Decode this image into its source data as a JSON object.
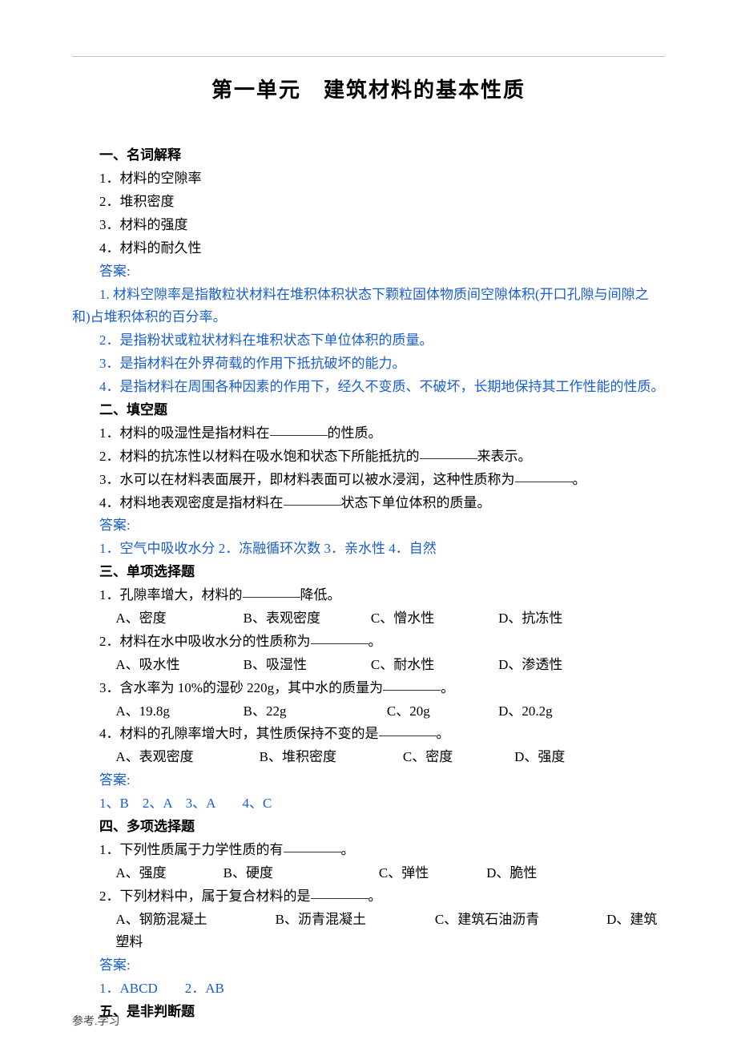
{
  "title": "第一单元　建筑材料的基本性质",
  "s1": {
    "heading": "一、名词解释",
    "items": [
      "1．材料的空隙率",
      "2．堆积密度",
      "3．材料的强度",
      "4．材料的耐久性"
    ],
    "answer_label": "答案:",
    "answers": [
      "1. 材料空隙率是指散粒状材料在堆积体积状态下颗粒固体物质间空隙体积(开口孔隙与间隙之和)占堆积体积的百分率。",
      "2．是指粉状或粒状材料在堆积状态下单位体积的质量。",
      "3．是指材料在外界荷载的作用下抵抗破坏的能力。",
      "4．是指材料在周围各种因素的作用下，经久不变质、不破坏，长期地保持其工作性能的性质。"
    ]
  },
  "s2": {
    "heading": "二、填空题",
    "q1a": "1．材料的吸湿性是指材料在",
    "q1b": "的性质。",
    "q2a": "2．材料的抗冻性以材料在吸水饱和状态下所能抵抗的",
    "q2b": "来表示。",
    "q3a": "3．水可以在材料表面展开，即材料表面可以被水浸润，这种性质称为",
    "q3b": "。",
    "q4a": "4．材料地表观密度是指材料在",
    "q4b": "状态下单位体积的质量。",
    "answer_label": "答案:",
    "answers_line": "1．空气中吸收水分 2．冻融循环次数 3．亲水性 4．自然"
  },
  "s3": {
    "heading": "三、单项选择题",
    "q1_text": "1．孔隙率增大，材料的",
    "q1_tail": "降低。",
    "q1_opts": {
      "A": "A、密度",
      "B": "B、表观密度",
      "C": "C、憎水性",
      "D": "D、抗冻性"
    },
    "q2_text": "2．材料在水中吸收水分的性质称为",
    "q2_tail": "。",
    "q2_opts": {
      "A": "A、吸水性",
      "B": "B、吸湿性",
      "C": "C、耐水性",
      "D": "D、渗透性"
    },
    "q3_text": "3．含水率为 10%的湿砂 220g，其中水的质量为",
    "q3_tail": "。",
    "q3_opts": {
      "A": "A、19.8g",
      "B": "B、22g",
      "C": "C、20g",
      "D": "D、20.2g"
    },
    "q4_text": "4．材料的孔隙率增大时，其性质保持不变的是",
    "q4_tail": "。",
    "q4_opts": {
      "A": "A、表观密度",
      "B": "B、堆积密度",
      "C": "C、密度",
      "D": "D、强度"
    },
    "answer_label": "答案:",
    "answers_line": "1、B　2、A　3、A　　4、C"
  },
  "s4": {
    "heading": "四、多项选择题",
    "q1_text": "1．下列性质属于力学性质的有",
    "q1_tail": "。",
    "q1_opts": {
      "A": "A、强度",
      "B": "B、硬度",
      "C": "C、弹性",
      "D": "D、脆性"
    },
    "q2_text": "2．下列材料中，属于复合材料的是",
    "q2_tail": "。",
    "q2_opts": {
      "A": "A、钢筋混凝土",
      "B": "B、沥青混凝土",
      "C": "C、建筑石油沥青",
      "D": "D、建筑塑料"
    },
    "answer_label": "答案:",
    "answers_line": "1．ABCD　　2．AB"
  },
  "s5": {
    "heading": "五、是非判断题"
  },
  "footer": "参考.学习"
}
